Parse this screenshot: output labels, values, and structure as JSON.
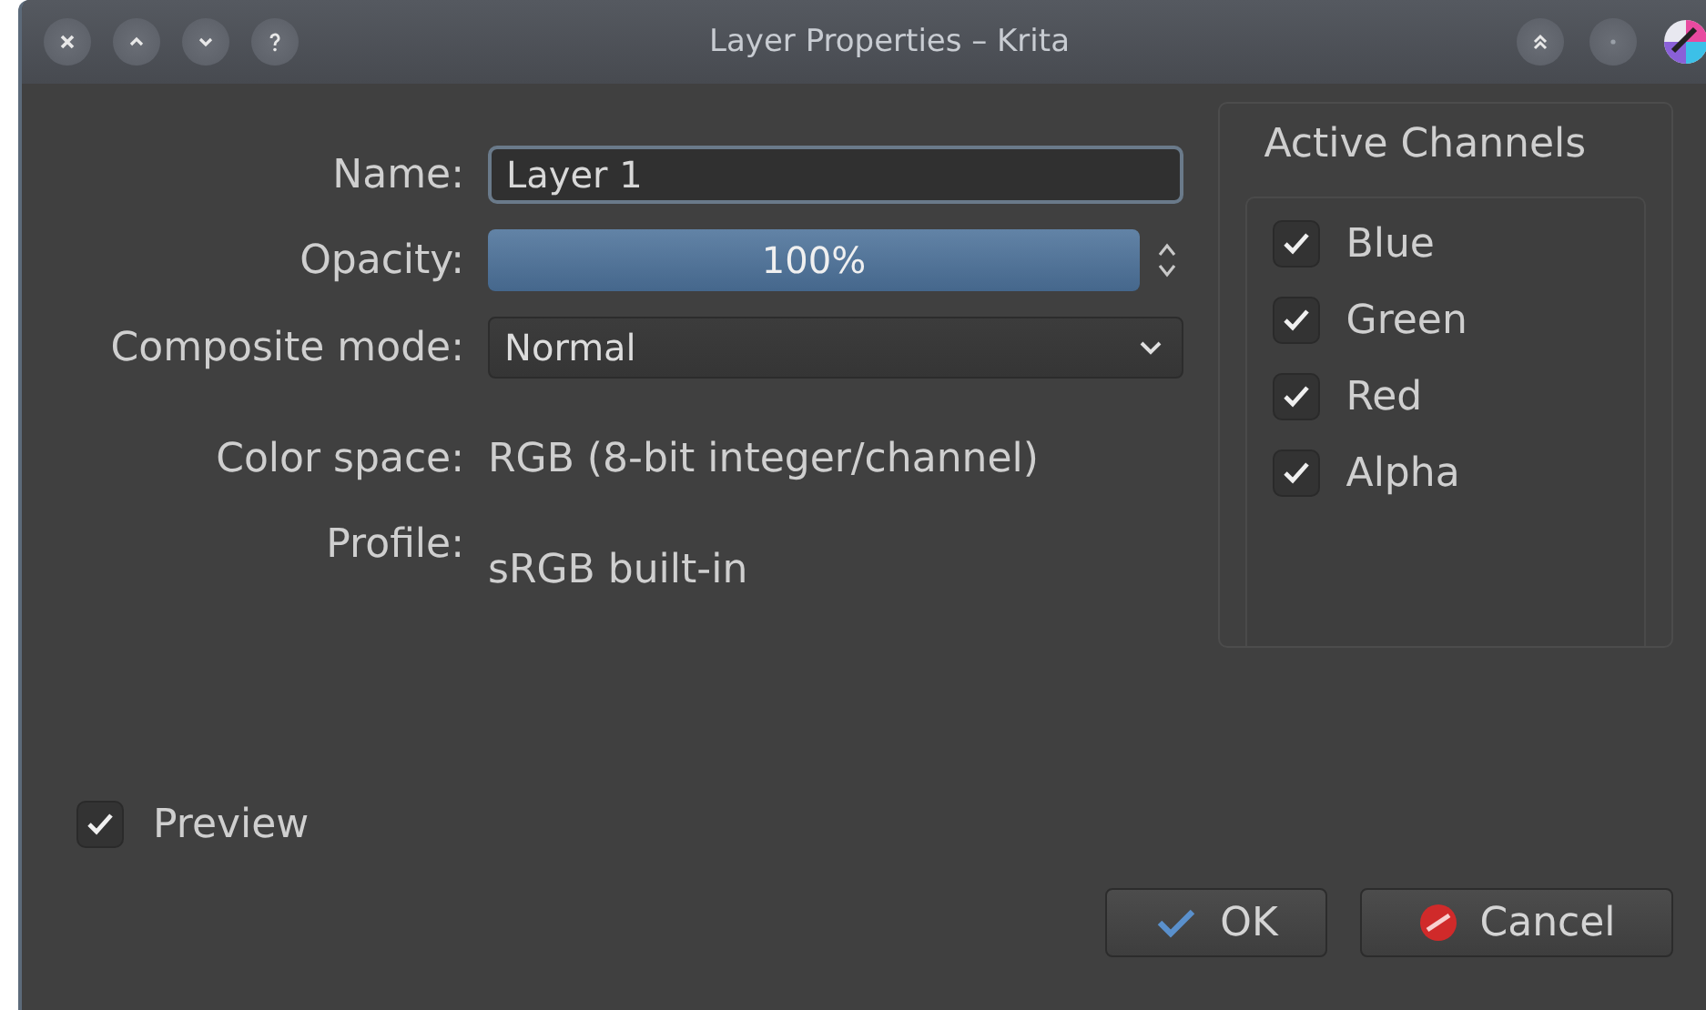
{
  "window": {
    "title": "Layer Properties – Krita"
  },
  "form": {
    "name": {
      "label": "Name:",
      "value": "Layer 1"
    },
    "opacity": {
      "label": "Opacity:",
      "reading": "100%",
      "level": 1
    },
    "composite_mode": {
      "label": "Composite mode:",
      "value": "Normal"
    },
    "color_space": {
      "label": "Color space:",
      "value": "RGB (8-bit integer/channel)"
    },
    "profile": {
      "label": "Profile:",
      "value": "sRGB built-in"
    }
  },
  "active_channels": {
    "title": "Active Channels",
    "channels": [
      {
        "label": "Blue",
        "checked": true
      },
      {
        "label": "Green",
        "checked": true
      },
      {
        "label": "Red",
        "checked": true
      },
      {
        "label": "Alpha",
        "checked": true
      }
    ]
  },
  "preview": {
    "label": "Preview",
    "checked": true
  },
  "buttons": [
    {
      "kind": "ok",
      "label": "OK"
    },
    {
      "kind": "cancel",
      "label": "Cancel"
    }
  ]
}
